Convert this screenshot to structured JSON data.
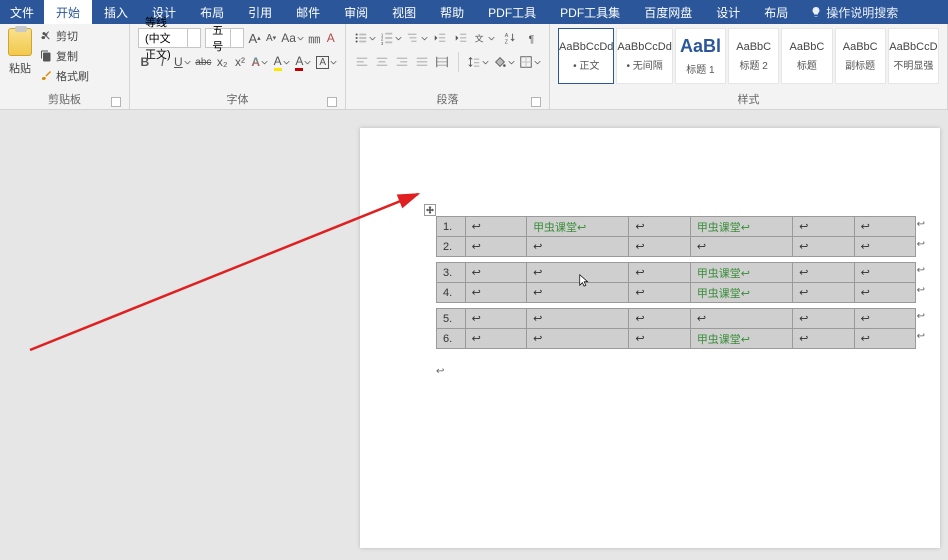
{
  "tabs": {
    "file": "文件",
    "home": "开始",
    "insert": "插入",
    "design": "设计",
    "layout": "布局",
    "references": "引用",
    "mailings": "邮件",
    "review": "审阅",
    "view": "视图",
    "help": "帮助",
    "pdf_tool": "PDF工具",
    "pdf_toolset": "PDF工具集",
    "baidu": "百度网盘",
    "design2": "设计",
    "layout2": "布局",
    "tell_me": "操作说明搜索"
  },
  "clipboard": {
    "paste": "粘贴",
    "cut": "剪切",
    "copy": "复制",
    "format_painter": "格式刷",
    "group_label": "剪贴板"
  },
  "font": {
    "name": "等线 (中文正文)",
    "size": "五号",
    "group_label": "字体",
    "letters": {
      "aup": "A",
      "adown": "A",
      "aa": "Aa",
      "clr": "A"
    },
    "bold": "B",
    "italic": "I",
    "underline": "U",
    "strike": "abc",
    "sub": "x₂",
    "sup": "x²",
    "hi": "A",
    "color": "A"
  },
  "paragraph": {
    "group_label": "段落"
  },
  "styles": {
    "group_label": "样式",
    "items": [
      {
        "preview": "AaBbCcDd",
        "name": "• 正文"
      },
      {
        "preview": "AaBbCcDd",
        "name": "• 无间隔"
      },
      {
        "preview": "AaBl",
        "name": "标题 1",
        "big": true
      },
      {
        "preview": "AaBbC",
        "name": "标题 2"
      },
      {
        "preview": "AaBbC",
        "name": "标题"
      },
      {
        "preview": "AaBbC",
        "name": "副标题"
      },
      {
        "preview": "AaBbCcD",
        "name": "不明显强"
      }
    ]
  },
  "table": {
    "rows": [
      {
        "n": "1.",
        "c1": "↩",
        "c2": "甲虫课堂↩",
        "c3": "↩",
        "c4": "甲虫课堂↩",
        "c5": "↩",
        "c6": "↩"
      },
      {
        "n": "2.",
        "c1": "↩",
        "c2": "↩",
        "c3": "↩",
        "c4": "↩",
        "c5": "↩",
        "c6": "↩"
      },
      {
        "n": "3.",
        "c1": "↩",
        "c2": "↩",
        "c3": "↩",
        "c4": "甲虫课堂↩",
        "c5": "↩",
        "c6": "↩"
      },
      {
        "n": "4.",
        "c1": "↩",
        "c2": "↩",
        "c3": "↩",
        "c4": "甲虫课堂↩",
        "c5": "↩",
        "c6": "↩"
      },
      {
        "n": "5.",
        "c1": "↩",
        "c2": "↩",
        "c3": "↩",
        "c4": "↩",
        "c5": "↩",
        "c6": "↩"
      },
      {
        "n": "6.",
        "c1": "↩",
        "c2": "↩",
        "c3": "↩",
        "c4": "甲虫课堂↩",
        "c5": "↩",
        "c6": "↩"
      }
    ],
    "end_mark": "↩"
  }
}
